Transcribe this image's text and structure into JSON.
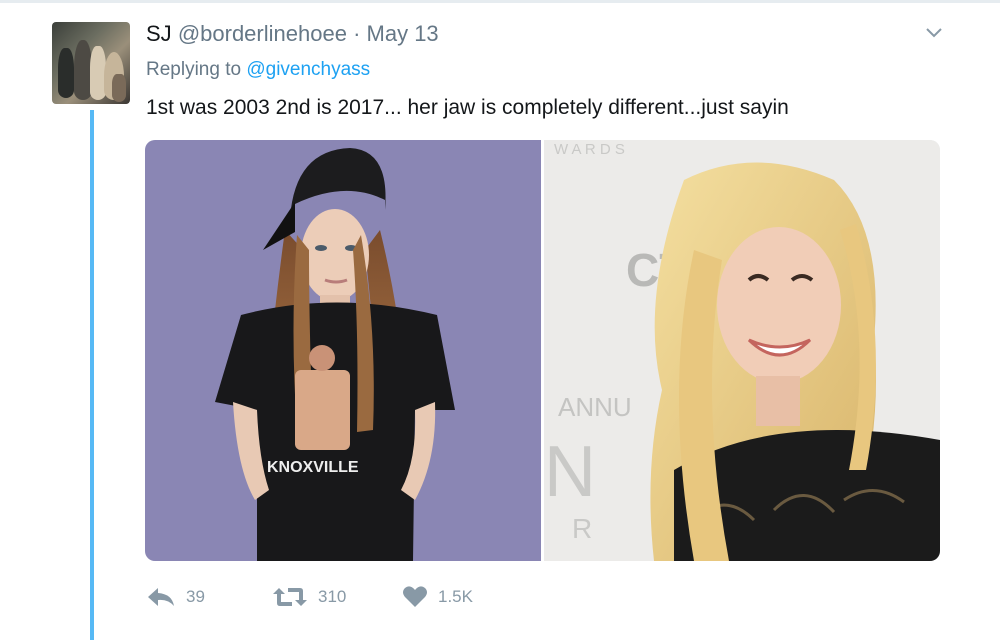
{
  "tweet": {
    "display_name": "SJ",
    "handle": "@borderlinehoee",
    "separator": "·",
    "date": "May 13",
    "replying_prefix": "Replying to",
    "replying_to": "@givenchyass",
    "text": "1st was 2003 2nd is 2017... her jaw is completely different...just sayin",
    "media": {
      "left_shirt_text": "KNOXVILLE",
      "right_backdrop_top": "W A R D S",
      "right_logo": "CT",
      "right_annual": "ANNU",
      "right_letter_n": "N",
      "right_letter_r": "R"
    },
    "actions": {
      "reply_count": "39",
      "retweet_count": "310",
      "like_count": "1.5K"
    }
  },
  "icons": {
    "more": "chevron-down-icon",
    "reply": "reply-icon",
    "retweet": "retweet-icon",
    "like": "heart-icon"
  },
  "colors": {
    "accent": "#1da1f2",
    "secondary_text": "#657786",
    "icon_gray": "#8899a6",
    "left_photo_bg": "#8a86b4",
    "right_photo_bg": "#ecebe9"
  }
}
